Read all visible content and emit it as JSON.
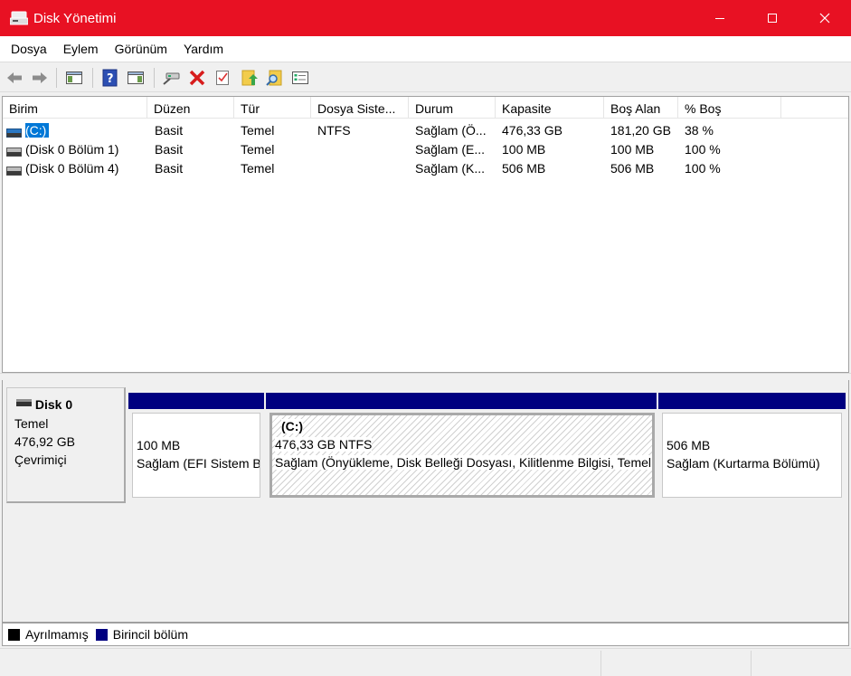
{
  "window": {
    "title": "Disk Yönetimi"
  },
  "menu": [
    "Dosya",
    "Eylem",
    "Görünüm",
    "Yardım"
  ],
  "toolbar": [
    "back-icon",
    "forward-icon",
    "console-tree-icon",
    "help-icon",
    "show-pane-icon",
    "connect-disk-icon",
    "delete-icon",
    "check-icon",
    "open-icon",
    "search-icon",
    "properties-icon"
  ],
  "volume_list": {
    "columns": [
      "Birim",
      "Düzen",
      "Tür",
      "Dosya Siste...",
      "Durum",
      "Kapasite",
      "Boş Alan",
      "% Boş"
    ],
    "rows": [
      {
        "name": "(C:)",
        "layout": "Basit",
        "type": "Temel",
        "fs": "NTFS",
        "status": "Sağlam (Ö...",
        "capacity": "476,33 GB",
        "free": "181,20 GB",
        "pct": "38 %",
        "selected": true
      },
      {
        "name": "(Disk 0 Bölüm 1)",
        "layout": "Basit",
        "type": "Temel",
        "fs": "",
        "status": "Sağlam (E...",
        "capacity": "100 MB",
        "free": "100 MB",
        "pct": "100 %"
      },
      {
        "name": "(Disk 0 Bölüm 4)",
        "layout": "Basit",
        "type": "Temel",
        "fs": "",
        "status": "Sağlam (K...",
        "capacity": "506 MB",
        "free": "506 MB",
        "pct": "100 %"
      }
    ]
  },
  "disk": {
    "name": "Disk 0",
    "type": "Temel",
    "size": "476,92 GB",
    "state": "Çevrimiçi",
    "partitions": [
      {
        "label": "",
        "size": "100 MB",
        "status": "Sağlam (EFI Sistem Bölümü)"
      },
      {
        "label": "(C:)",
        "size": "476,33 GB NTFS",
        "status": "Sağlam (Önyükleme, Disk Belleği Dosyası, Kilitlenme Bilgisi, Temel Veri Bölümü)"
      },
      {
        "label": "",
        "size": "506 MB",
        "status": "Sağlam (Kurtarma Bölümü)"
      }
    ]
  },
  "legend": [
    {
      "label": "Ayrılmamış",
      "color": "#000000"
    },
    {
      "label": "Birincil bölüm",
      "color": "#000080"
    }
  ]
}
